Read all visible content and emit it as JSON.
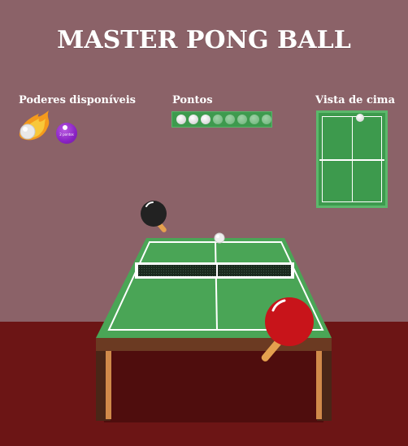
{
  "title": "MASTER PONG BALL",
  "powers": {
    "label": "Poderes disponíveis",
    "items": [
      {
        "icon": "flaming-ball-icon"
      },
      {
        "icon": "purple-orb-icon",
        "text": "2 pontos"
      }
    ]
  },
  "points": {
    "label": "Pontos",
    "total": 8,
    "earned": 3
  },
  "top_view": {
    "label": "Vista de cima"
  },
  "colors": {
    "wall": "#8b6268",
    "floor": "#6c1515",
    "table": "#4aa556",
    "player_paddle": "#c8141a",
    "opponent_paddle": "#222222"
  }
}
